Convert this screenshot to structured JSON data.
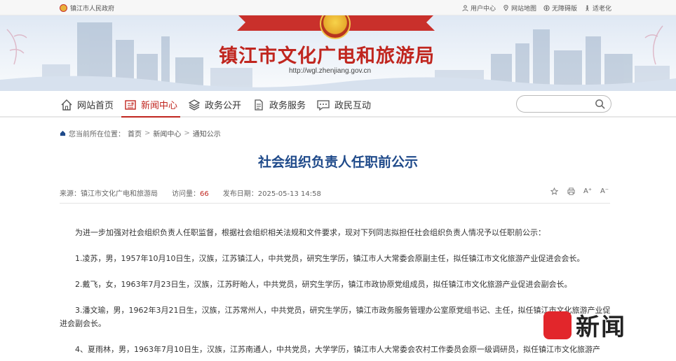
{
  "topbar": {
    "gov_link": "镇江市人民政府",
    "links": [
      {
        "label": "用户中心",
        "icon": "user-icon"
      },
      {
        "label": "网站地图",
        "icon": "map-pin-icon"
      },
      {
        "label": "无障碍版",
        "icon": "accessibility-icon"
      },
      {
        "label": "适老化",
        "icon": "elder-mode-icon"
      }
    ]
  },
  "banner": {
    "site_title": "镇江市文化广电和旅游局",
    "site_url": "http://wgl.zhenjiang.gov.cn"
  },
  "nav": {
    "items": [
      {
        "label": "网站首页",
        "icon": "home-icon"
      },
      {
        "label": "新闻中心",
        "icon": "news-icon",
        "active": true
      },
      {
        "label": "政务公开",
        "icon": "layers-icon"
      },
      {
        "label": "政务服务",
        "icon": "document-icon"
      },
      {
        "label": "政民互动",
        "icon": "chat-icon"
      }
    ],
    "search_placeholder": ""
  },
  "breadcrumb": {
    "prefix": "您当前所在位置：",
    "items": [
      "首页",
      "新闻中心",
      "通知公示"
    ],
    "sep": ">"
  },
  "article": {
    "title": "社会组织负责人任职前公示",
    "source_label": "来源：",
    "source": "镇江市文化广电和旅游局",
    "hits_label": "访问量：",
    "hits": "66",
    "date_label": "发布日期：",
    "date": "2025-05-13 14:58",
    "paragraphs": [
      "为进一步加强对社会组织负责人任职监督，根据社会组织相关法规和文件要求，现对下列同志拟担任社会组织负责人情况予以任职前公示：",
      "1.凌苏，男，1957年10月10日生，汉族，江苏镇江人，中共党员，研究生学历，镇江市人大常委会原副主任，拟任镇江市文化旅游产业促进会会长。",
      "2.戴飞，女，1963年7月23日生，汉族，江苏盱眙人，中共党员，研究生学历，镇江市政协原党组成员，拟任镇江市文化旅游产业促进会副会长。",
      "3.潘文瑜，男，1962年3月21日生，汉族，江苏常州人，中共党员，研究生学历，镇江市政务服务管理办公室原党组书记、主任，拟任镇江市文化旅游产业促进会副会长。",
      "4、夏雨林，男，1963年7月10日生，汉族，江苏南通人，中共党员，大学学历，镇江市人大常委会农村工作委员会原一级调研员，拟任镇江市文化旅游产"
    ]
  },
  "tools": [
    "star-icon",
    "print-icon",
    "font-larger-icon",
    "font-smaller-icon"
  ],
  "tool_labels": [
    "A⁺",
    "A⁻"
  ],
  "watermark": {
    "text": "新闻"
  },
  "colors": {
    "accent_red": "#c0261f",
    "title_blue": "#1f4a8a"
  }
}
